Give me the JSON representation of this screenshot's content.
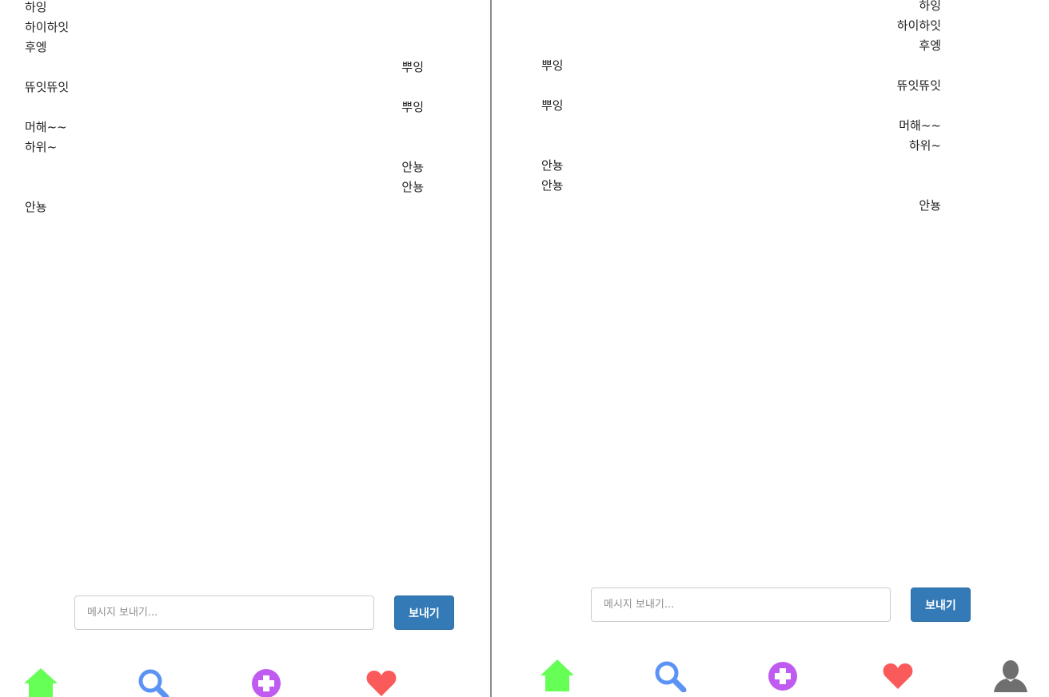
{
  "left": {
    "messages": [
      {
        "text": "하잉",
        "side": "mine"
      },
      {
        "text": "하이하잇",
        "side": "mine"
      },
      {
        "text": "후엥",
        "side": "mine"
      },
      {
        "text": "뿌잉",
        "side": "theirs"
      },
      {
        "text": "뜌잇뜌잇",
        "side": "mine"
      },
      {
        "text": "뿌잉",
        "side": "theirs"
      },
      {
        "text": "머해~~",
        "side": "mine"
      },
      {
        "text": "하위~",
        "side": "mine"
      },
      {
        "text": "안뇽",
        "side": "theirs"
      },
      {
        "text": "안뇽",
        "side": "theirs"
      },
      {
        "text": "안뇽",
        "side": "mine"
      }
    ],
    "composer": {
      "placeholder": "메시지 보내기...",
      "send_label": "보내기"
    },
    "nav": [
      "home-icon",
      "search-icon",
      "add-icon",
      "heart-icon"
    ]
  },
  "right": {
    "messages": [
      {
        "text": "하잉",
        "side": "mine"
      },
      {
        "text": "하이하잇",
        "side": "mine"
      },
      {
        "text": "후엥",
        "side": "mine"
      },
      {
        "text": "뿌잉",
        "side": "theirs"
      },
      {
        "text": "뜌잇뜌잇",
        "side": "mine"
      },
      {
        "text": "뿌잉",
        "side": "theirs"
      },
      {
        "text": "머해~~",
        "side": "mine"
      },
      {
        "text": "하위~",
        "side": "mine"
      },
      {
        "text": "안뇽",
        "side": "theirs"
      },
      {
        "text": "안뇽",
        "side": "theirs"
      },
      {
        "text": "안뇽",
        "side": "mine"
      }
    ],
    "composer": {
      "placeholder": "메시지 보내기...",
      "send_label": "보내기"
    },
    "nav": [
      "home-icon",
      "search-icon",
      "add-icon",
      "heart-icon",
      "profile-icon"
    ]
  },
  "colors": {
    "home": "#66ff55",
    "search": "#5b93f5",
    "add": "#bf5bf0",
    "heart": "#fa5a5a",
    "profile": "#6f6f6f",
    "send_button": "#337ab7"
  }
}
